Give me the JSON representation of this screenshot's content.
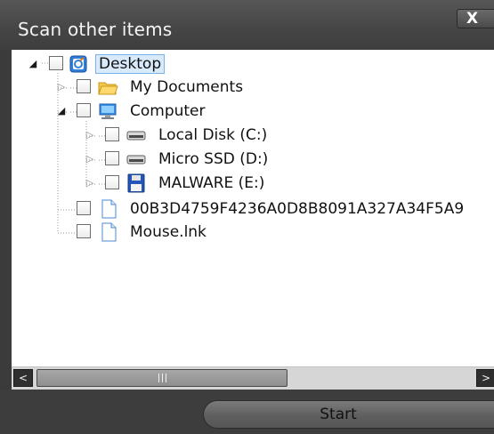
{
  "dialog": {
    "title": "Scan other items",
    "close_label": "X"
  },
  "tree": {
    "items": [
      {
        "label": "Desktop",
        "icon": "desktop-icon",
        "expanded": true,
        "selected": true
      },
      {
        "label": "My Documents",
        "icon": "folder-icon",
        "expanded": false
      },
      {
        "label": "Computer",
        "icon": "computer-icon",
        "expanded": true
      },
      {
        "label": "Local Disk (C:)",
        "icon": "drive-icon",
        "expanded": false
      },
      {
        "label": "Micro SSD (D:)",
        "icon": "drive-icon",
        "expanded": false
      },
      {
        "label": "MALWARE (E:)",
        "icon": "floppy-icon",
        "expanded": false
      },
      {
        "label": "00B3D4759F4236A0D8B8091A327A34F5A9",
        "icon": "file-icon"
      },
      {
        "label": "Mouse.lnk",
        "icon": "file-icon"
      }
    ]
  },
  "scrollbar": {
    "left_arrow": "<",
    "right_arrow": ">"
  },
  "footer": {
    "start_label": "Start"
  },
  "colors": {
    "dialog_background": "#3b3b3b",
    "title_text": "#f4f4f4",
    "selection_fill": "#d8eafc",
    "selection_border": "#7db2e6"
  }
}
